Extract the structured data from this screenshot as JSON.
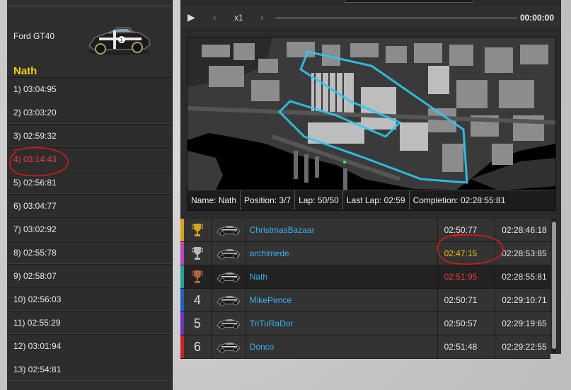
{
  "car": {
    "name": "Ford GT40",
    "image_icon": "race-car-icon"
  },
  "driver": "Nath",
  "laps": [
    {
      "label": "1) 03:04:95",
      "highlight": false
    },
    {
      "label": "2) 03:03:20",
      "highlight": false
    },
    {
      "label": "3) 02:59:32",
      "highlight": false
    },
    {
      "label": "4) 03:14:43",
      "highlight": true
    },
    {
      "label": "5) 02:56:81",
      "highlight": false
    },
    {
      "label": "6) 03:04:77",
      "highlight": false
    },
    {
      "label": "7) 03:02:92",
      "highlight": false
    },
    {
      "label": "8) 02:55:78",
      "highlight": false
    },
    {
      "label": "9) 02:58:07",
      "highlight": false
    },
    {
      "label": "10) 02:56:03",
      "highlight": false
    },
    {
      "label": "11) 02:55:29",
      "highlight": false
    },
    {
      "label": "12) 03:01:94",
      "highlight": false
    },
    {
      "label": "13) 02:54:81",
      "highlight": false
    }
  ],
  "player": {
    "play_icon": "▶",
    "prev_icon": "‹",
    "next_icon": "›",
    "speed": "x1",
    "time": "00:00:00"
  },
  "info": {
    "name_label": "Name:",
    "name_value": "Nath",
    "position_label": "Position:",
    "position_value": "3/7",
    "lap_label": "Lap:",
    "lap_value": "50/50",
    "last_lap_label": "Last Lap:",
    "last_lap_value": "02:59",
    "completion_label": "Completion:",
    "completion_value": "02:28:55:81"
  },
  "leaderboard": [
    {
      "pos": "",
      "trophy": "gold",
      "stripe": "#d8a020",
      "name": "ChristmasBazaar",
      "best": "02:50:77",
      "best_style": "normal",
      "total": "02:28:46:18"
    },
    {
      "pos": "",
      "trophy": "silver",
      "stripe": "#c040c0",
      "name": "archimede",
      "best": "02:47:15",
      "best_style": "gold",
      "total": "02:28:53:85"
    },
    {
      "pos": "",
      "trophy": "bronze",
      "stripe": "#20a090",
      "name": "Nath",
      "best": "02:51:95",
      "best_style": "red",
      "total": "02:28:55:81"
    },
    {
      "pos": "4",
      "trophy": "",
      "stripe": "#2060c0",
      "name": "MikePence",
      "best": "02:50:71",
      "best_style": "normal",
      "total": "02:29:10:71"
    },
    {
      "pos": "5",
      "trophy": "",
      "stripe": "#7030c0",
      "name": "TriTuRaDor",
      "best": "02:50:57",
      "best_style": "normal",
      "total": "02:29:19:65"
    },
    {
      "pos": "6",
      "trophy": "",
      "stripe": "#d02020",
      "name": "Donco",
      "best": "02:51:48",
      "best_style": "normal",
      "total": "02:29:22:55"
    }
  ],
  "colors": {
    "driver": "#f0d000",
    "player_name": "#3ab0ee",
    "annotation": "#e01818",
    "track": "#2fc8f0"
  }
}
